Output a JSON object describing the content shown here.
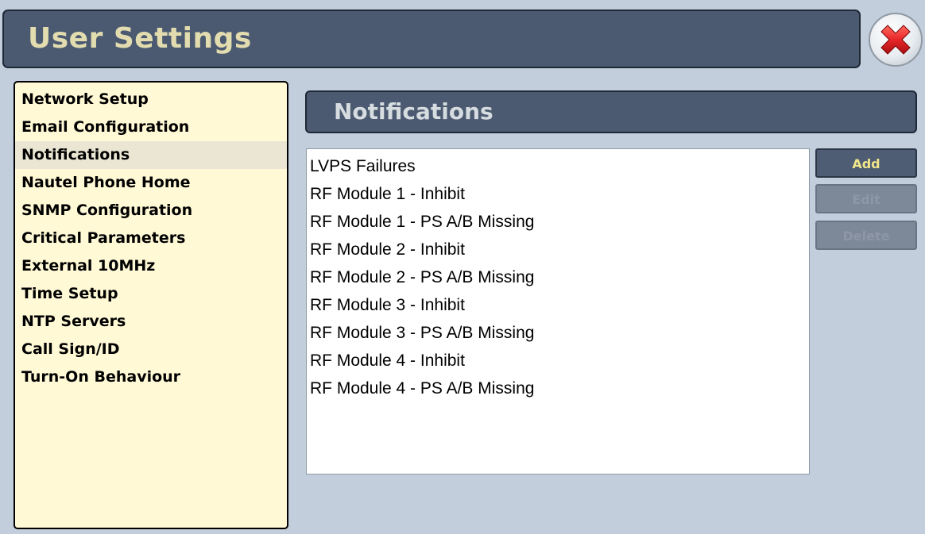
{
  "header": {
    "title": "User Settings"
  },
  "sidebar": {
    "active_index": 2,
    "items": [
      {
        "label": "Network Setup"
      },
      {
        "label": "Email Configuration"
      },
      {
        "label": "Notifications"
      },
      {
        "label": "Nautel Phone Home"
      },
      {
        "label": "SNMP Configuration"
      },
      {
        "label": "Critical Parameters"
      },
      {
        "label": "External 10MHz"
      },
      {
        "label": "Time Setup"
      },
      {
        "label": "NTP Servers"
      },
      {
        "label": "Call Sign/ID"
      },
      {
        "label": "Turn-On Behaviour"
      }
    ]
  },
  "main": {
    "section_title": "Notifications",
    "notifications": [
      "LVPS Failures",
      "RF Module 1 - Inhibit",
      "RF Module 1 - PS A/B Missing",
      "RF Module 2 - Inhibit",
      "RF Module 2 - PS A/B Missing",
      "RF Module 3 - Inhibit",
      "RF Module 3 - PS A/B Missing",
      "RF Module 4 - Inhibit",
      "RF Module 4 - PS A/B Missing"
    ],
    "buttons": {
      "add": "Add",
      "edit": "Edit",
      "delete": "Delete"
    }
  },
  "icons": {
    "close": "close-x-icon"
  },
  "colors": {
    "header_bg": "#4b5a71",
    "title_text": "#e2dcaf",
    "sidebar_bg": "#fff9d6",
    "add_text": "#f2e68a",
    "close_red": "#e8262a"
  }
}
